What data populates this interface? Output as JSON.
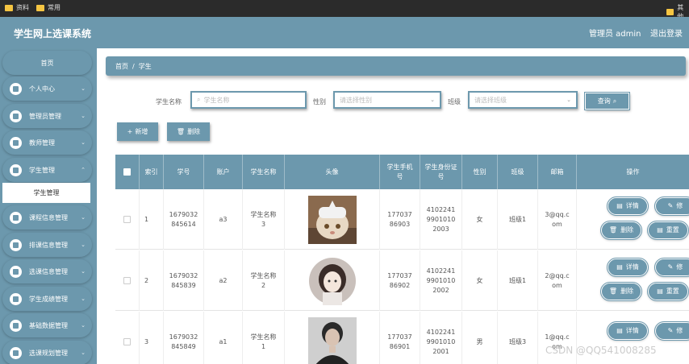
{
  "browser_bar": {
    "bookmark1": "资料",
    "bookmark2": "常用",
    "bookmark3": "其他"
  },
  "header": {
    "title": "学生网上选课系统",
    "admin": "管理员 admin",
    "logout": "退出登录"
  },
  "sidebar": {
    "home": "首页",
    "items": [
      {
        "label": "个人中心",
        "icon": "user-icon"
      },
      {
        "label": "管理员管理",
        "icon": "admin-icon"
      },
      {
        "label": "教师管理",
        "icon": "grid-icon"
      },
      {
        "label": "学生管理",
        "icon": "book-icon"
      },
      {
        "label": "课程信息管理",
        "icon": "calendar-icon"
      },
      {
        "label": "排课信息管理",
        "icon": "thumb-icon"
      },
      {
        "label": "选课信息管理",
        "icon": "person-icon"
      },
      {
        "label": "学生成绩管理",
        "icon": "grid-icon"
      },
      {
        "label": "基础数据管理",
        "icon": "grid-icon"
      },
      {
        "label": "选课规划管理",
        "icon": "grid-icon"
      }
    ],
    "active_sub": "学生管理"
  },
  "breadcrumb": {
    "home": "首页",
    "sep": "/",
    "current": "学生"
  },
  "filters": {
    "name_label": "学生名称",
    "name_placeholder": "学生名称",
    "gender_label": "性别",
    "gender_placeholder": "请选择性别",
    "class_label": "班级",
    "class_placeholder": "请选择班级",
    "query_label": "查询"
  },
  "actions": {
    "add": "新增",
    "delete": "删除"
  },
  "table": {
    "headers": [
      "索引",
      "学号",
      "账户",
      "学生名称",
      "头像",
      "学生手机号",
      "学生身份证号",
      "性别",
      "班级",
      "邮箱",
      "操作"
    ],
    "rows": [
      {
        "index": "1",
        "id": "1679032845614",
        "account": "a3",
        "name": "学生名称3",
        "phone": "17703786903",
        "idcard": "410224199010102003",
        "gender": "女",
        "class": "班级1",
        "email": "3@qq.com"
      },
      {
        "index": "2",
        "id": "1679032845839",
        "account": "a2",
        "name": "学生名称2",
        "phone": "17703786902",
        "idcard": "410224199010102002",
        "gender": "女",
        "class": "班级1",
        "email": "2@qq.com"
      },
      {
        "index": "3",
        "id": "1679032845849",
        "account": "a1",
        "name": "学生名称1",
        "phone": "17703786901",
        "idcard": "410224199010102001",
        "gender": "男",
        "class": "班级3",
        "email": "1@qq.com"
      }
    ],
    "ops": {
      "detail": "详情",
      "edit": "修",
      "delete": "删除",
      "reset": "重置"
    }
  },
  "watermark": "CSDN @QQ541008285",
  "colors": {
    "accent": "#6c98ad",
    "topbar": "#6c98ad",
    "bookmark_bar": "#2b2b2b"
  }
}
